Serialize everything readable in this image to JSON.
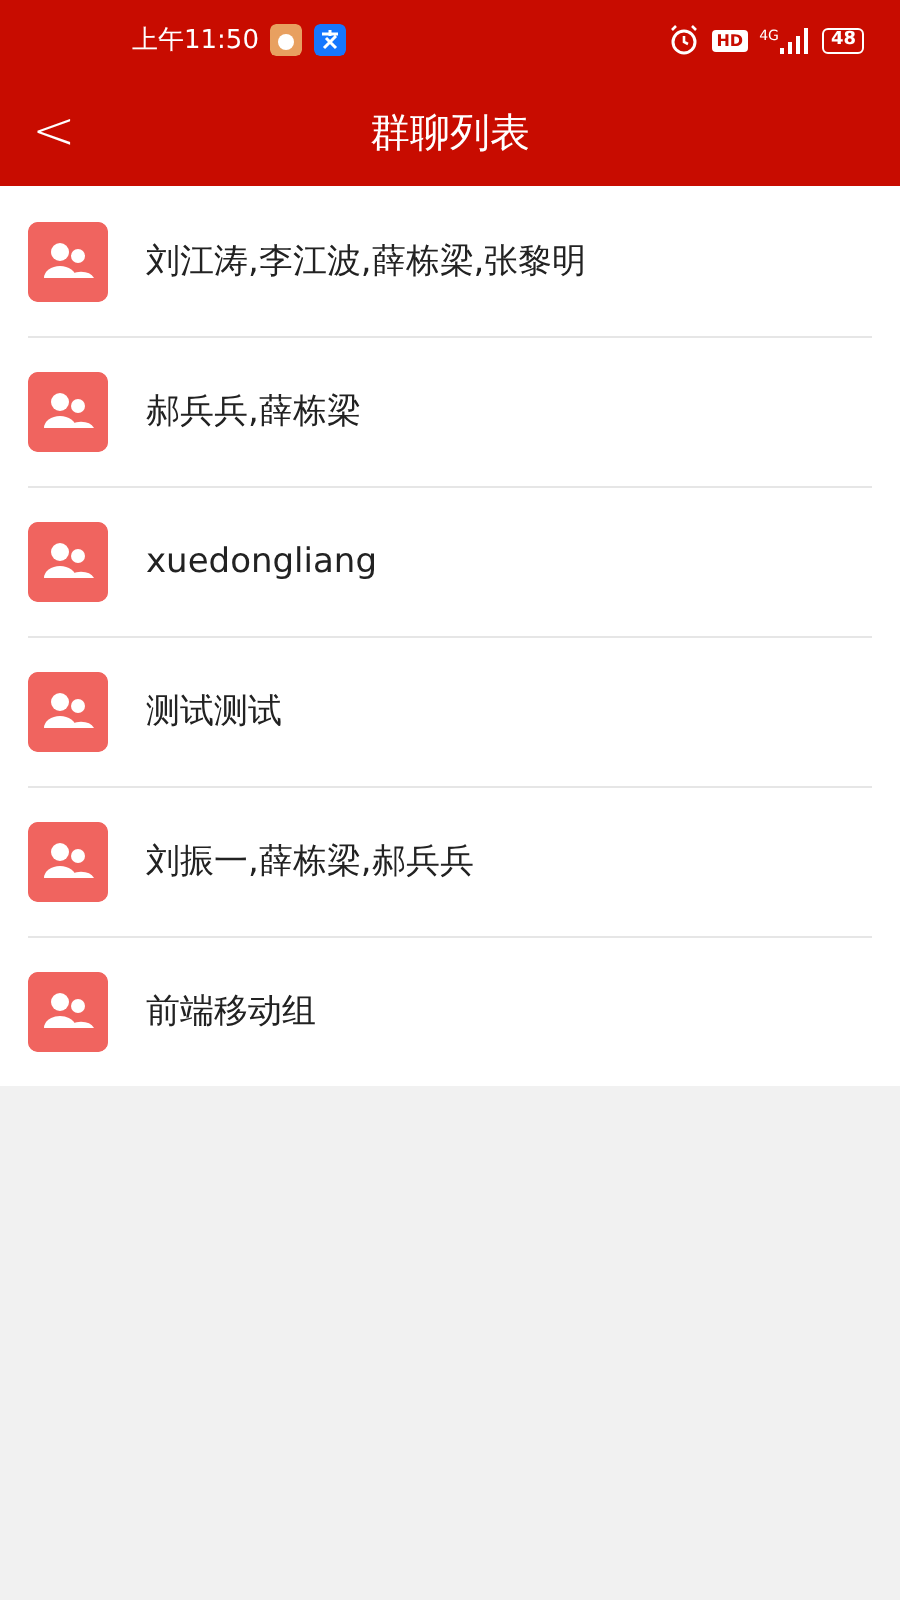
{
  "status_bar": {
    "time": "上午11:50",
    "hd": "HD",
    "network": "4G",
    "battery": "48"
  },
  "header": {
    "back": "<",
    "title": "群聊列表"
  },
  "groups": [
    {
      "name": "刘江涛,李江波,薛栋梁,张黎明"
    },
    {
      "name": "郝兵兵,薛栋梁"
    },
    {
      "name": "xuedongliang"
    },
    {
      "name": "测试测试"
    },
    {
      "name": "刘振一,薛栋梁,郝兵兵"
    },
    {
      "name": "前端移动组"
    }
  ]
}
